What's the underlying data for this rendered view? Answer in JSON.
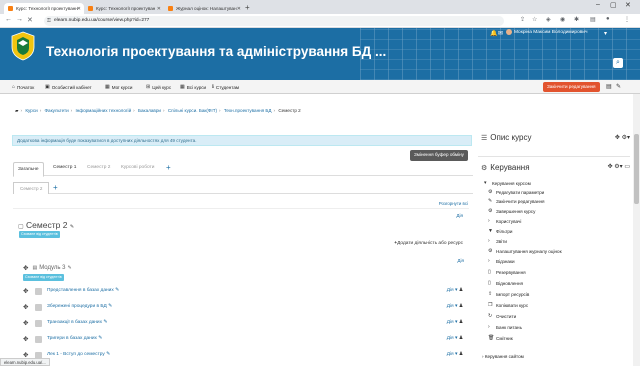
{
  "browser": {
    "tabs": [
      {
        "title": "Курс: Технології проектуванн",
        "active": true
      },
      {
        "title": "Курс: Технології проектуван"
      },
      {
        "title": "Журнал оцінок: Налаштуван"
      }
    ],
    "new_tab": "+",
    "url": "elearn.nubip.edu.ua/course/view.php?id=277"
  },
  "header": {
    "site_title": "Технологія проектування та адміністрування БД ...",
    "user_name": "Мокріна Максим Володимирович"
  },
  "menu": {
    "items": [
      {
        "label": "Початок",
        "icon": "home-icon"
      },
      {
        "label": "Особистий кабінет",
        "icon": "dashboard-icon"
      },
      {
        "label": "Мої курси",
        "icon": "courses-icon"
      },
      {
        "label": "Цей курс",
        "icon": "sitemap-icon"
      },
      {
        "label": "Всі курси",
        "icon": "grid-icon"
      },
      {
        "label": "Студентам",
        "icon": "info-icon"
      }
    ],
    "edit_button": "Закінчити редагування"
  },
  "breadcrumb": [
    "Курси",
    "Факультети",
    "Інформаційних технологій",
    "Бакалаври",
    "Спільні курси. Бак(ФІТ)",
    "Техн.проектування БД",
    "Семестр 2"
  ],
  "alert": "Додаткова інформація буде показуватися в доступних діяльностях для 49 студента.",
  "switch_button": "Змінення буфер обміну",
  "course_tabs": [
    {
      "label": "Загальне",
      "state": "active"
    },
    {
      "label": "Семестр 1",
      "state": "normal"
    },
    {
      "label": "Семестр 2",
      "state": "disabled"
    },
    {
      "label": "Курсові роботи",
      "state": "disabled"
    }
  ],
  "sub_tab": "Семестр 2",
  "collapse_all": "Розгорнути всі",
  "section": {
    "title": "Семестр 2",
    "badge": "Сховане від студентів",
    "edit": "Дія",
    "add_activity": "Додати діяльність або ресурс"
  },
  "module": {
    "title": "Модуль 3",
    "badge": "Сховане від студентів",
    "edit": "Дія"
  },
  "activities": [
    {
      "name": "Представлення в базах даних",
      "action": "Дія"
    },
    {
      "name": "Збережені процедури в БД",
      "action": "Дія"
    },
    {
      "name": "Транзакції в базах даних",
      "action": "Дія"
    },
    {
      "name": "Тригери в базах даних",
      "action": "Дія"
    },
    {
      "name": "Лек 1 - Вступ до семестру",
      "action": "Дія"
    }
  ],
  "sidebar": {
    "course_desc": "Опис курсу",
    "admin_title": "Керування",
    "course_admin": "Керування курсом",
    "admin_items": [
      {
        "label": "Редагувати параметри",
        "icon": "gear-icon"
      },
      {
        "label": "Закінчити редагування",
        "icon": "pencil-icon"
      },
      {
        "label": "Завершення курсу",
        "icon": "gear-icon"
      },
      {
        "label": "Користувачі",
        "icon": "chevron-right-icon"
      },
      {
        "label": "Фільтри",
        "icon": "filter-icon"
      },
      {
        "label": "Звіти",
        "icon": "chevron-right-icon"
      },
      {
        "label": "Налаштування журналу оцінок",
        "icon": "gear-icon"
      },
      {
        "label": "Відзнаки",
        "icon": "chevron-right-icon"
      },
      {
        "label": "Резервування",
        "icon": "file-icon"
      },
      {
        "label": "Відновлення",
        "icon": "file-icon"
      },
      {
        "label": "Імпорт ресурсів",
        "icon": "upload-icon"
      },
      {
        "label": "Копіювати курс",
        "icon": "copy-icon"
      },
      {
        "label": "Очистити",
        "icon": "recycle-icon"
      },
      {
        "label": "Банк питань",
        "icon": "chevron-right-icon"
      },
      {
        "label": "Смітник",
        "icon": "trash-icon"
      }
    ],
    "site_admin": "Керування сайтом"
  },
  "status_bar": "elearn.nubip.edu.ua/..."
}
